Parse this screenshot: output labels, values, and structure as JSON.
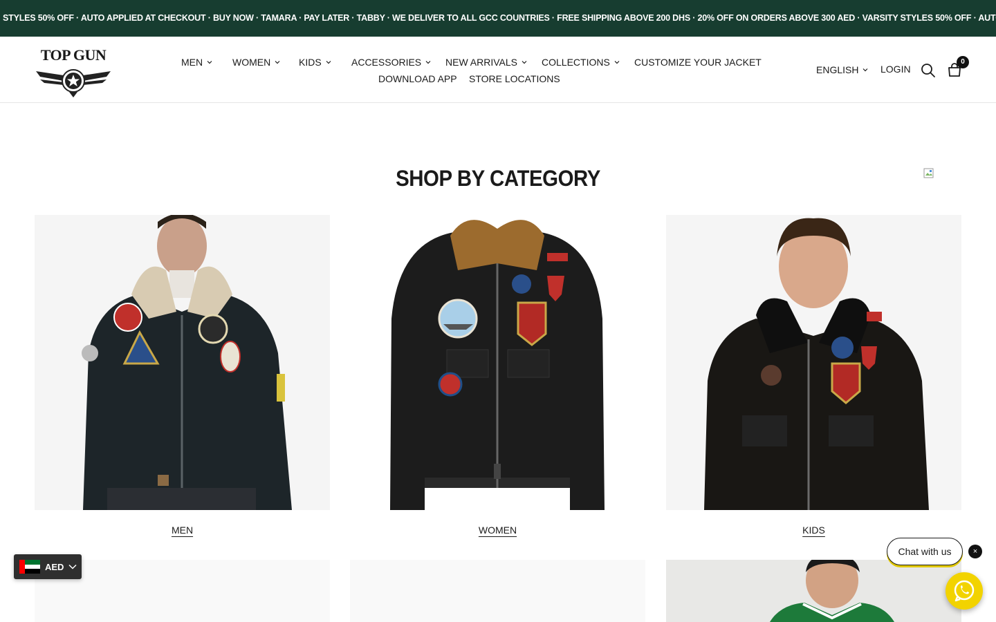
{
  "announcement": {
    "text": "STYLES 50% OFF · AUTO APPLIED AT CHECKOUT ·   BUY NOW · TAMARA · PAY LATER · TABBY · WE DELIVER TO ALL GCC COUNTRIES · FREE SHIPPING ABOVE 200 DHS · 20% OFF ON ORDERS ABOVE 300 AED · VARSITY STYLES 50% OFF · AUTO APPLIED AT CH",
    "bg_color": "#173d30"
  },
  "header": {
    "logo_text": "TOP GUN",
    "nav": [
      {
        "label": "MEN",
        "dropdown": true
      },
      {
        "label": "WOMEN",
        "dropdown": true
      },
      {
        "label": "KIDS",
        "dropdown": true
      },
      {
        "label": "ACCESSORIES",
        "dropdown": true
      },
      {
        "label": "NEW ARRIVALS",
        "dropdown": true
      },
      {
        "label": "COLLECTIONS",
        "dropdown": true
      },
      {
        "label": "CUSTOMIZE YOUR JACKET",
        "dropdown": false
      },
      {
        "label": "DOWNLOAD APP",
        "dropdown": false
      },
      {
        "label": "STORE LOCATIONS",
        "dropdown": false
      }
    ],
    "language": "ENGLISH",
    "login": "LOGIN",
    "cart_count": "0",
    "icons": [
      "search-icon",
      "cart-icon"
    ]
  },
  "main": {
    "section_title": "SHOP BY CATEGORY",
    "categories": [
      {
        "label": "MEN"
      },
      {
        "label": "WOMEN"
      },
      {
        "label": "KIDS"
      }
    ]
  },
  "widgets": {
    "currency": "AED",
    "chat_label": "Chat with us",
    "chat_close": "×",
    "accent_color": "#f2d300"
  }
}
